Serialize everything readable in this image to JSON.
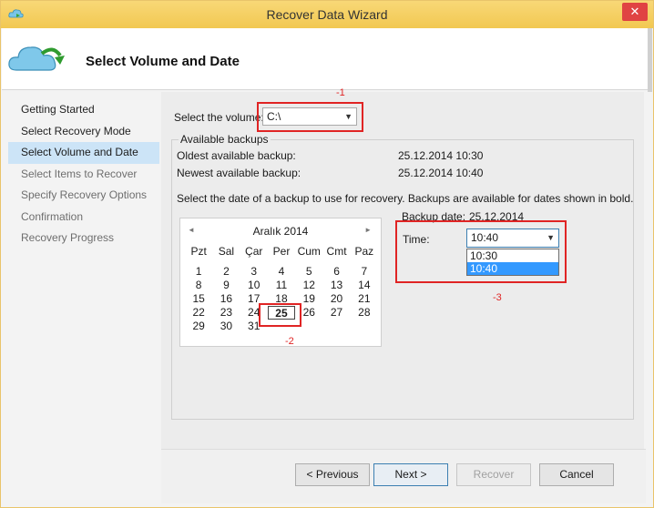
{
  "window": {
    "title": "Recover Data Wizard",
    "close_glyph": "✕"
  },
  "header": {
    "title": "Select Volume and Date",
    "icon": "cloud-recover-icon"
  },
  "nav": {
    "items": [
      {
        "label": "Getting Started",
        "state": "normal"
      },
      {
        "label": "Select Recovery Mode",
        "state": "normal"
      },
      {
        "label": "Select Volume and Date",
        "state": "selected"
      },
      {
        "label": "Select Items to Recover",
        "state": "disabled"
      },
      {
        "label": "Specify Recovery Options",
        "state": "disabled"
      },
      {
        "label": "Confirmation",
        "state": "disabled"
      },
      {
        "label": "Recovery Progress",
        "state": "disabled"
      }
    ]
  },
  "annotations": {
    "a1": "-1",
    "a2": "-2",
    "a3": "-3",
    "color": "#e02424"
  },
  "volume": {
    "label": "Select the volume:",
    "value": "C:\\"
  },
  "backups": {
    "group_title": "Available backups",
    "oldest_label": "Oldest available backup:",
    "oldest_value": "25.12.2014 10:30",
    "newest_label": "Newest available backup:",
    "newest_value": "25.12.2014 10:40"
  },
  "instruction": "Select the date of a backup to use for recovery. Backups are available for dates shown in bold.",
  "calendar": {
    "month": "Aralık 2014",
    "prev": "◄",
    "next": "►",
    "days_of_week": [
      "Pzt",
      "Sal",
      "Çar",
      "Per",
      "Cum",
      "Cmt",
      "Paz"
    ],
    "weeks": [
      [
        "1",
        "2",
        "3",
        "4",
        "5",
        "6",
        "7"
      ],
      [
        "8",
        "9",
        "10",
        "11",
        "12",
        "13",
        "14"
      ],
      [
        "15",
        "16",
        "17",
        "18",
        "19",
        "20",
        "21"
      ],
      [
        "22",
        "23",
        "24",
        "25",
        "26",
        "27",
        "28"
      ],
      [
        "29",
        "30",
        "31",
        "",
        "",
        "",
        ""
      ]
    ],
    "selected_day": "25"
  },
  "backup_date": {
    "label": "Backup date:",
    "value": "25.12.2014"
  },
  "time": {
    "label": "Time:",
    "value": "10:40",
    "options": [
      "10:30",
      "10:40"
    ],
    "highlighted": "10:40"
  },
  "buttons": {
    "previous": "< Previous",
    "next": "Next >",
    "recover": "Recover",
    "cancel": "Cancel"
  }
}
